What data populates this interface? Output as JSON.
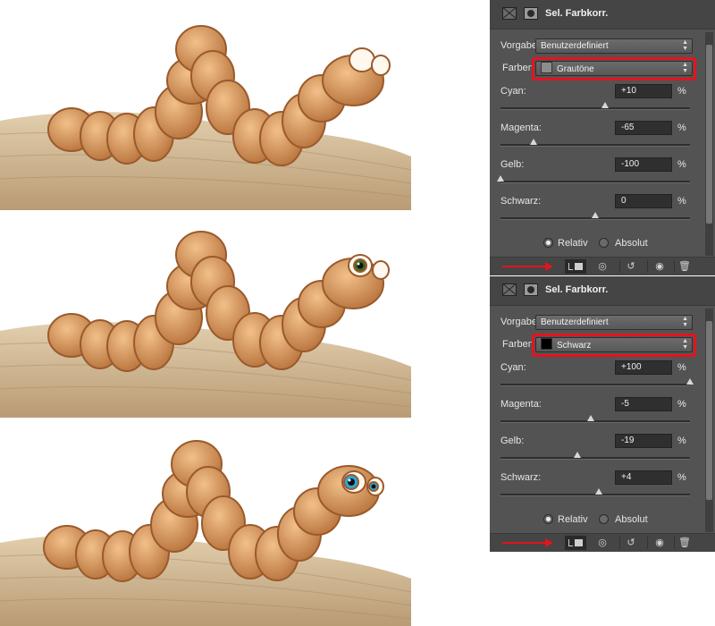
{
  "panels": [
    {
      "title": "Sel. Farbkorr.",
      "vorgabe_label": "Vorgabe:",
      "vorgabe_value": "Benutzerdefiniert",
      "farben_label": "Farben",
      "farben_value": "Grautöne",
      "farben_swatch_color": "#8c8c8c",
      "sliders": [
        {
          "label": "Cyan:",
          "value": "+10",
          "percent": 10
        },
        {
          "label": "Magenta:",
          "value": "-65",
          "percent": -65
        },
        {
          "label": "Gelb:",
          "value": "-100",
          "percent": -100
        },
        {
          "label": "Schwarz:",
          "value": "0",
          "percent": 0
        }
      ],
      "unit": "%",
      "radio_relativ": "Relativ",
      "radio_absolut": "Absolut",
      "selected_mode": "Relativ"
    },
    {
      "title": "Sel. Farbkorr.",
      "vorgabe_label": "Vorgabe:",
      "vorgabe_value": "Benutzerdefiniert",
      "farben_label": "Farben",
      "farben_value": "Schwarz",
      "farben_swatch_color": "#000000",
      "sliders": [
        {
          "label": "Cyan:",
          "value": "+100",
          "percent": 100
        },
        {
          "label": "Magenta:",
          "value": "-5",
          "percent": -5
        },
        {
          "label": "Gelb:",
          "value": "-19",
          "percent": -19
        },
        {
          "label": "Schwarz:",
          "value": "+4",
          "percent": 4
        }
      ],
      "unit": "%",
      "radio_relativ": "Relativ",
      "radio_absolut": "Absolut",
      "selected_mode": "Relativ"
    }
  ],
  "colors": {
    "highlight": "#e2141f",
    "panel_bg": "#535353",
    "worm_body": "#d08a4e",
    "worm_outline": "#9a5a2c",
    "ground": "#c8ad86",
    "eye_stage2": "#3a6b2a",
    "eye_stage3": "#2aa8d8"
  },
  "illustrations": [
    {
      "name": "worm-stage-1-eyes-blank"
    },
    {
      "name": "worm-stage-2-eyes-dark"
    },
    {
      "name": "worm-stage-3-eyes-blue"
    }
  ],
  "footer_icons": [
    "clip-to-layer-icon",
    "view-previous-icon",
    "reset-icon",
    "visibility-icon",
    "trash-icon"
  ]
}
